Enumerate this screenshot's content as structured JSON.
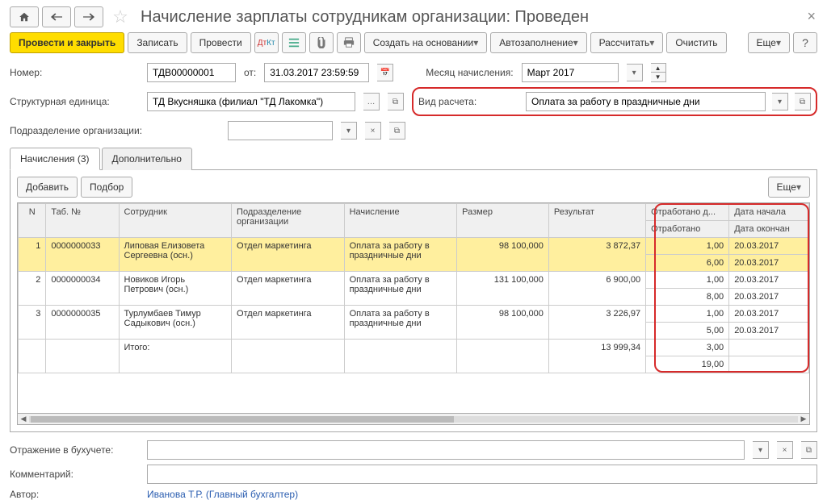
{
  "title": "Начисление зарплаты сотрудникам организации: Проведен",
  "toolbar": {
    "post_close": "Провести и закрыть",
    "save": "Записать",
    "post": "Провести",
    "create_based": "Создать на основании",
    "autofill": "Автозаполнение",
    "calc": "Рассчитать",
    "clear": "Очистить",
    "more": "Еще"
  },
  "form": {
    "number_label": "Номер:",
    "number_value": "ТДВ00000001",
    "from_label": "от:",
    "date_value": "31.03.2017 23:59:59",
    "month_label": "Месяц начисления:",
    "month_value": "Март 2017",
    "unit_label": "Структурная единица:",
    "unit_value": "ТД Вкусняшка (филиал \"ТД Лакомка\")",
    "calc_type_label": "Вид расчета:",
    "calc_type_value": "Оплата за работу в праздничные дни",
    "subdiv_label": "Подразделение организации:",
    "subdiv_value": ""
  },
  "tabs": {
    "accruals": "Начисления (3)",
    "more": "Дополнительно"
  },
  "pane_toolbar": {
    "add": "Добавить",
    "pick": "Подбор",
    "more": "Еще"
  },
  "grid": {
    "headers": {
      "n": "N",
      "tabno": "Таб. №",
      "employee": "Сотрудник",
      "dept": "Подразделение организации",
      "accrual": "Начисление",
      "size": "Размер",
      "result": "Результат",
      "worked_d": "Отработано д...",
      "date_start": "Дата начала",
      "worked": "Отработано",
      "date_end": "Дата окончан"
    },
    "rows": [
      {
        "n": "1",
        "tabno": "0000000033",
        "employee": "Липовая Елизовета Сергеевна (осн.)",
        "dept": "Отдел маркетинга",
        "accrual": "Оплата за работу в праздничные дни",
        "size": "98 100,000",
        "result": "3 872,37",
        "worked_d": "1,00",
        "date_start": "20.03.2017",
        "worked": "6,00",
        "date_end": "20.03.2017"
      },
      {
        "n": "2",
        "tabno": "0000000034",
        "employee": "Новиков Игорь Петрович (осн.)",
        "dept": "Отдел маркетинга",
        "accrual": "Оплата за работу в праздничные дни",
        "size": "131 100,000",
        "result": "6 900,00",
        "worked_d": "1,00",
        "date_start": "20.03.2017",
        "worked": "8,00",
        "date_end": "20.03.2017"
      },
      {
        "n": "3",
        "tabno": "0000000035",
        "employee": "Турлумбаев Тимур Садыкович (осн.)",
        "dept": "Отдел маркетинга",
        "accrual": "Оплата за работу в праздничные дни",
        "size": "98 100,000",
        "result": "3 226,97",
        "worked_d": "1,00",
        "date_start": "20.03.2017",
        "worked": "5,00",
        "date_end": "20.03.2017"
      }
    ],
    "totals": {
      "label": "Итого:",
      "result": "13 999,34",
      "worked_d": "3,00",
      "worked": "19,00"
    }
  },
  "footer": {
    "accounting_label": "Отражение в бухучете:",
    "comment_label": "Комментарий:",
    "author_label": "Автор:",
    "author_value": "Иванова Т.Р. (Главный бухгалтер)"
  }
}
